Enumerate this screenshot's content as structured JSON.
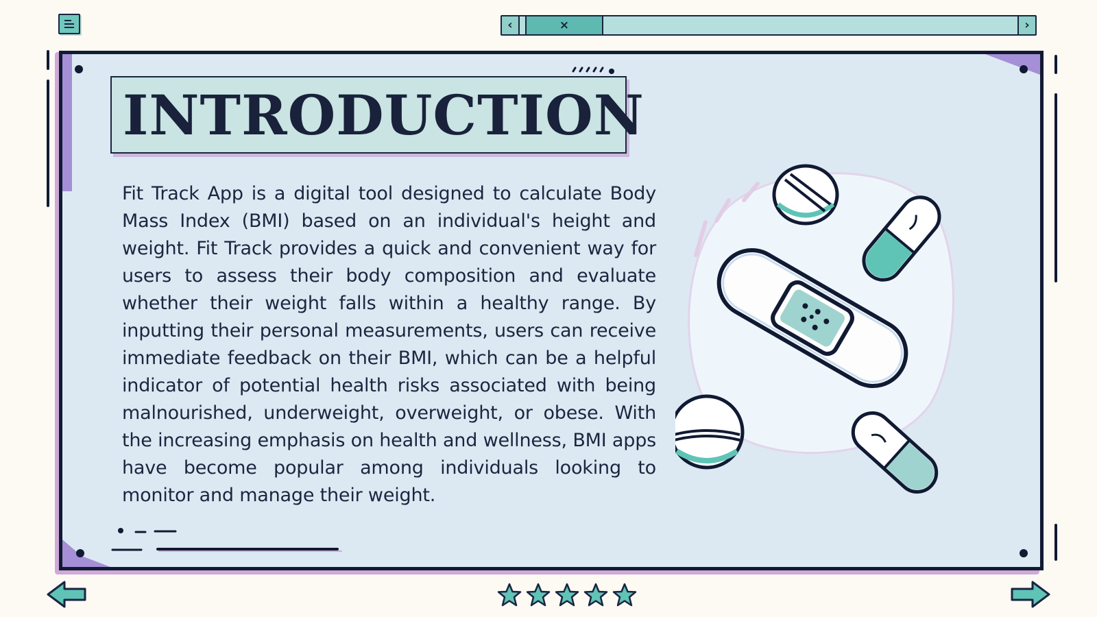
{
  "toolbar": {
    "menu_icon": "menu-lines-icon",
    "scroll_left_label": "‹",
    "scroll_right_label": "›",
    "scroll_thumb_label": "×"
  },
  "slide": {
    "title": "INTRODUCTION",
    "body": "Fit Track App is a digital tool designed to calculate Body Mass Index (BMI) based on an individual's height and weight. Fit Track provides a quick and convenient way for users to assess their body composition and evaluate whether their weight falls within a healthy range. By inputting their personal measurements, users can receive immediate feedback on their BMI, which can be a helpful indicator of potential health risks associated with being malnourished, underweight, overweight, or obese. With the increasing emphasis on health and wellness, BMI apps have become popular among individuals looking to monitor and manage their weight.",
    "illustration": [
      "bandage-icon",
      "pill-tablet-icon",
      "capsule-icon"
    ]
  },
  "navigation": {
    "prev_icon": "arrow-left-icon",
    "next_icon": "arrow-right-icon",
    "rating_count": 5
  },
  "colors": {
    "background": "#fdfaf4",
    "card": "#dce9f2",
    "accent_teal": "#5fc4b6",
    "accent_purple": "#a58fd6",
    "ink": "#111a33"
  }
}
